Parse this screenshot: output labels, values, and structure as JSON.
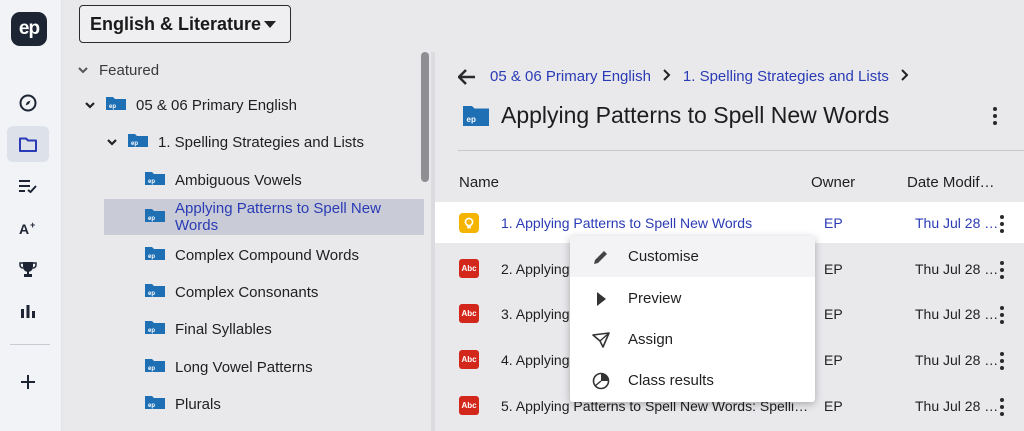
{
  "app": {
    "logo": "ep"
  },
  "rail": {
    "items": [
      {
        "icon": "compass-icon"
      },
      {
        "icon": "folder-icon",
        "active": true
      },
      {
        "icon": "checklist-icon"
      },
      {
        "icon": "grade-plus-icon"
      },
      {
        "icon": "trophy-icon"
      },
      {
        "icon": "bar-chart-icon"
      },
      {
        "icon": "plus-icon"
      }
    ]
  },
  "header": {
    "subject": "English & Literature"
  },
  "tree": {
    "featured_label": "Featured",
    "nodes": [
      {
        "label": "05 & 06 Primary English"
      },
      {
        "label": "1. Spelling Strategies and Lists"
      },
      {
        "label": "Ambiguous Vowels"
      },
      {
        "label": "Applying Patterns to Spell New Words",
        "selected": true
      },
      {
        "label": "Complex Compound Words"
      },
      {
        "label": "Complex Consonants"
      },
      {
        "label": "Final Syllables"
      },
      {
        "label": "Long Vowel Patterns"
      },
      {
        "label": "Plurals"
      }
    ]
  },
  "content": {
    "breadcrumbs": [
      "05 & 06 Primary English",
      "1. Spelling Strategies and Lists"
    ],
    "title": "Applying Patterns to Spell New Words",
    "columns": {
      "name": "Name",
      "owner": "Owner",
      "date": "Date Modif…"
    },
    "rows": [
      {
        "name": "1. Applying Patterns to Spell New Words",
        "owner": "EP",
        "date": "Thu Jul 28 …",
        "icon": "lesson-bulb-icon"
      },
      {
        "name": "2. Applying",
        "owner": "EP",
        "date": "Thu Jul 28 …",
        "icon": "spelling-abc-icon"
      },
      {
        "name": "3. Applying",
        "owner": "EP",
        "date": "Thu Jul 28 …",
        "icon": "spelling-abc-icon"
      },
      {
        "name": "4. Applying",
        "owner": "EP",
        "date": "Thu Jul 28 …",
        "icon": "spelling-abc-icon"
      },
      {
        "name": "5. Applying Patterns to Spell New Words: Spelli…",
        "owner": "EP",
        "date": "Thu Jul 28 …",
        "icon": "spelling-abc-icon"
      }
    ],
    "abc_label": "Abc"
  },
  "context_menu": {
    "items": [
      {
        "label": "Customise",
        "icon": "pencil-icon"
      },
      {
        "label": "Preview",
        "icon": "play-icon"
      },
      {
        "label": "Assign",
        "icon": "send-icon"
      },
      {
        "label": "Class results",
        "icon": "pie-chart-icon"
      }
    ]
  },
  "colors": {
    "link": "#2a3bb5",
    "folder": "#1f6fb5",
    "abc": "#d4271c",
    "bulb": "#f4b400"
  }
}
